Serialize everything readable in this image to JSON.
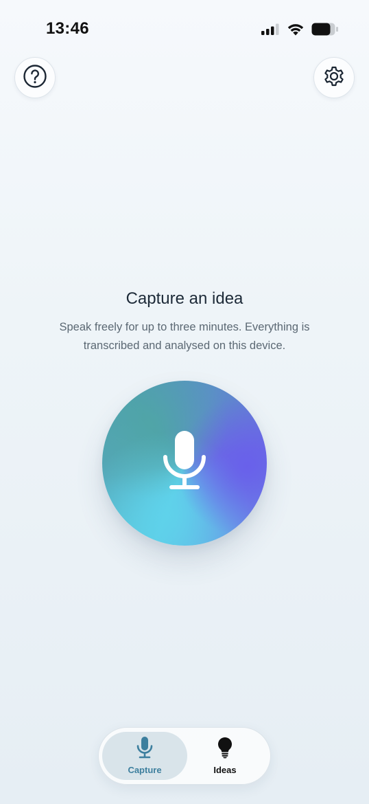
{
  "status_bar": {
    "time": "13:46",
    "icons": [
      "cellular-signal-icon",
      "wifi-icon",
      "battery-icon"
    ]
  },
  "header": {
    "help_icon": "question-mark-circle-icon",
    "settings_icon": "gear-icon"
  },
  "main": {
    "title": "Capture an idea",
    "subtitle": "Speak freely for up to three minutes. Everything is transcribed and analysed on this device.",
    "record_icon": "microphone-icon"
  },
  "tab_bar": {
    "tabs": [
      {
        "label": "Capture",
        "icon": "microphone-icon",
        "selected": true
      },
      {
        "label": "Ideas",
        "icon": "lightbulb-icon",
        "selected": false
      }
    ]
  },
  "colors": {
    "accent": "#3d7f9e",
    "selected_tab_bg": "#d9e4ea",
    "record_gradient_teal": "#5ecfe6",
    "record_gradient_violet": "#6a6fe0"
  }
}
